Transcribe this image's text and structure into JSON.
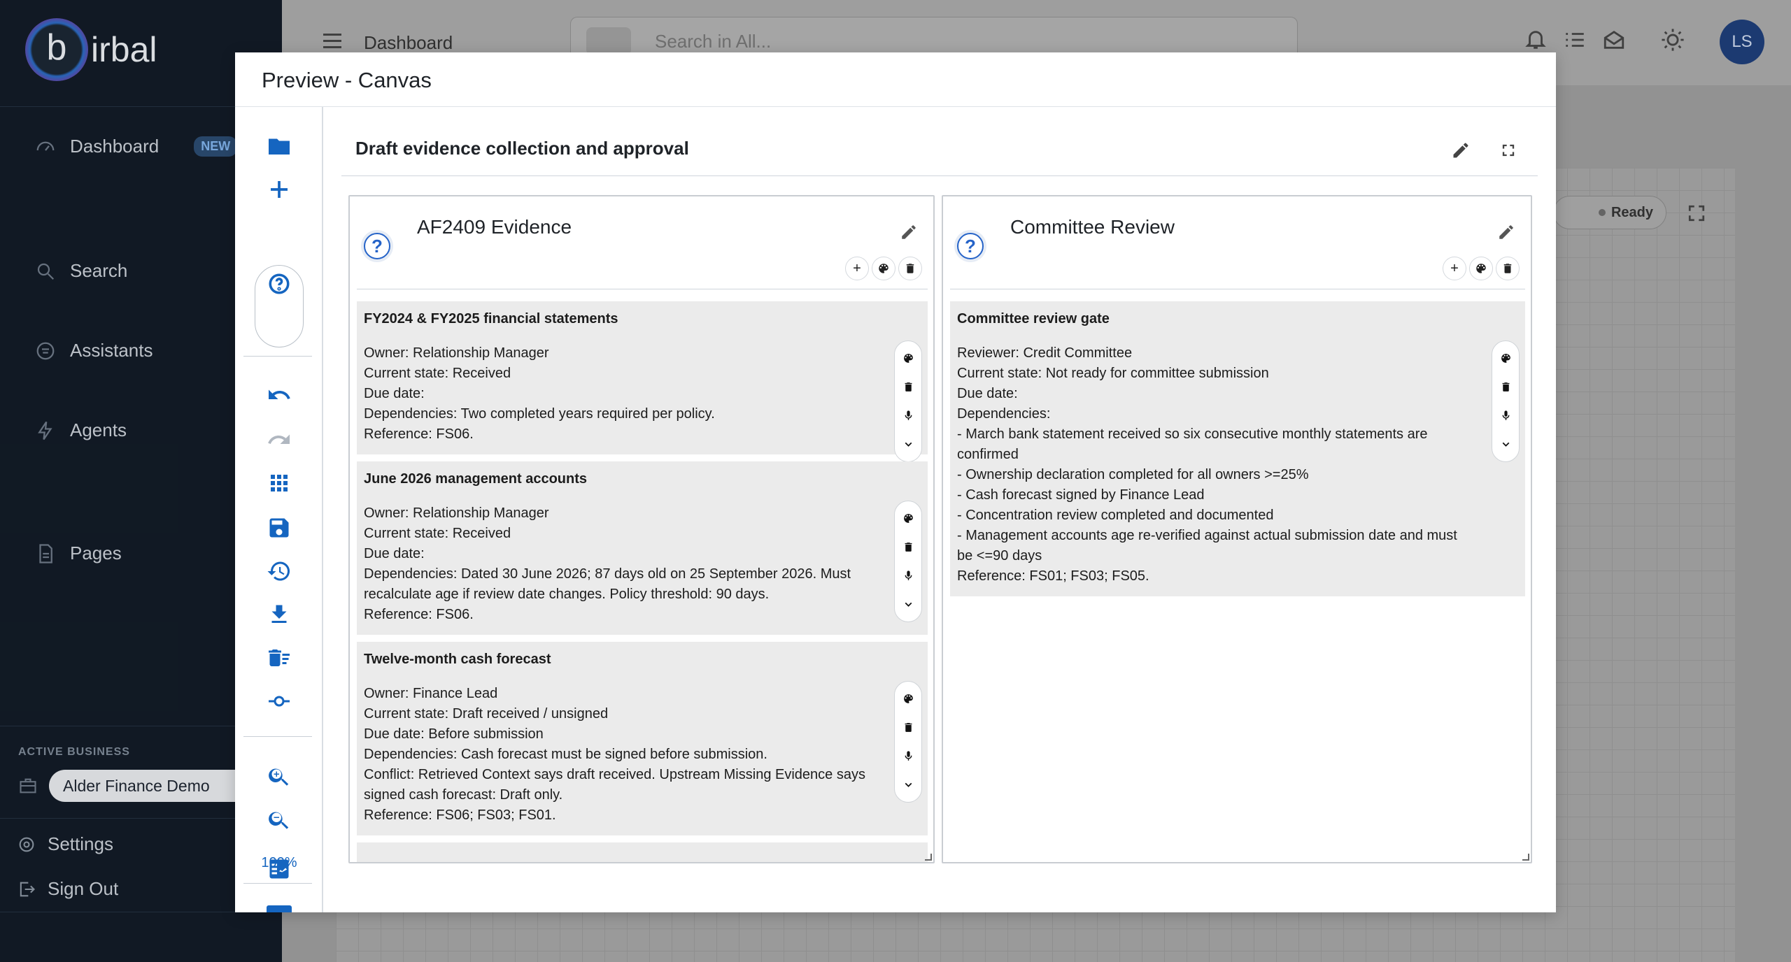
{
  "app": {
    "logo_letter": "b",
    "logo_text": "irbal",
    "header_title": "Dashboard",
    "search_placeholder": "Search in All...",
    "avatar_initials": "LS"
  },
  "sidebar": {
    "items": [
      {
        "label": "Dashboard",
        "badge": "NEW"
      },
      {
        "label": "Search"
      },
      {
        "label": "Assistants"
      },
      {
        "label": "Agents"
      },
      {
        "label": "Pages"
      }
    ],
    "active_business_label": "ACTIVE BUSINESS",
    "active_business": "Alder Finance Demo",
    "settings_label": "Settings",
    "signout_label": "Sign Out"
  },
  "background": {
    "status_label": "Ready"
  },
  "modal": {
    "title": "Preview - Canvas",
    "zoom": "100%",
    "section_title": "Draft evidence collection and approval",
    "cards": [
      {
        "title": "AF2409 Evidence",
        "help_glyph": "?",
        "entries": [
          {
            "heading": "FY2024 & FY2025 financial statements",
            "body": "Owner: Relationship Manager\nCurrent state: Received\nDue date:\nDependencies: Two completed years required per policy.\nReference: FS06."
          },
          {
            "heading": "June 2026 management accounts",
            "body": "Owner: Relationship Manager\nCurrent state: Received\nDue date:\nDependencies: Dated 30 June 2026; 87 days old on 25 September 2026. Must recalculate age if review date changes. Policy threshold: 90 days.\nReference: FS06."
          },
          {
            "heading": "Twelve-month cash forecast",
            "body": "Owner: Finance Lead\nCurrent state: Draft received / unsigned\nDue date: Before submission\nDependencies: Cash forecast must be signed before submission.\nConflict: Retrieved Context says draft received. Upstream Missing Evidence says signed cash forecast: Draft only.\nReference: FS06; FS03; FS01."
          }
        ]
      },
      {
        "title": "Committee Review",
        "help_glyph": "?",
        "entries": [
          {
            "heading": "Committee review gate",
            "body": "Reviewer: Credit Committee\nCurrent state: Not ready for committee submission\nDue date:\nDependencies:\n- March bank statement received so six consecutive monthly statements are confirmed\n- Ownership declaration completed for all owners >=25%\n- Cash forecast signed by Finance Lead\n- Concentration review completed and documented\n- Management accounts age re-verified against actual submission date and must be <=90 days\nReference: FS01; FS03; FS05."
          }
        ]
      }
    ]
  }
}
